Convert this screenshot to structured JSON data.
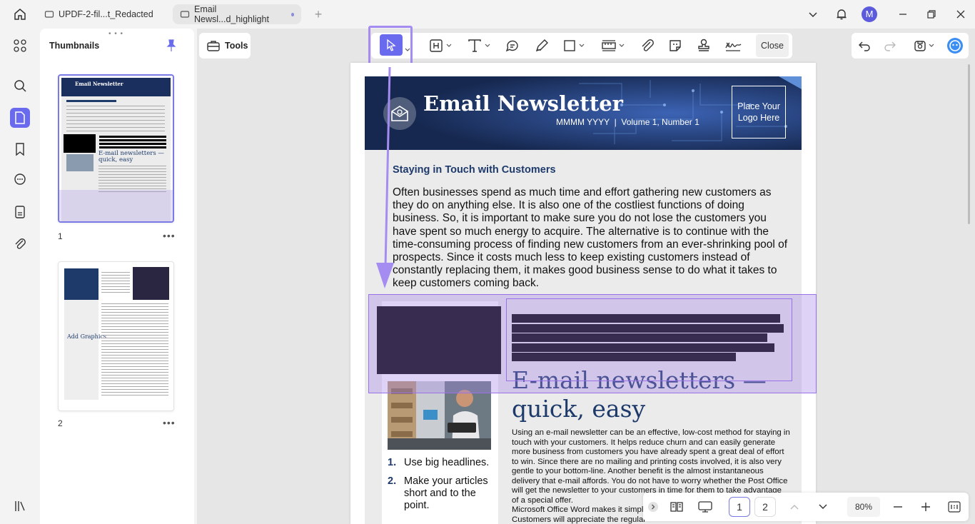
{
  "tabs": [
    {
      "label": "UPDF-2-fil...t_Redacted"
    },
    {
      "label": "Email Newsl...d_highlight"
    }
  ],
  "user": {
    "initial": "M"
  },
  "thumbnails": {
    "title": "Thumbnails",
    "pages": [
      {
        "number": "1"
      },
      {
        "number": "2"
      }
    ]
  },
  "toolbar": {
    "tools_label": "Tools",
    "close_label": "Close"
  },
  "document": {
    "banner_title": "Email Newsletter",
    "banner_subtitle": "MMMM YYYY  |  Volume 1, Number 1",
    "logo_placeholder": "Place Your Logo Here",
    "section_heading": "Staying in Touch with Customers",
    "section_body": "Often businesses spend as much time and effort gathering new customers as they do on anything else. It is also one of the costliest functions of doing business. So, it is important to make sure you do not lose the customers you have spent so much energy to acquire. The alternative is to continue with the time-consuming process of finding new customers from an ever-shrinking pool of prospects. Since it costs much less to keep existing customers instead of constantly replacing them, it makes good business sense to do what it takes to keep customers coming back.",
    "big_heading": "E-mail newsletters — quick, easy",
    "email_body": "Using an e-mail newsletter can be an effective, low-cost method for staying in touch with your customers. It helps reduce churn and can easily generate more business from customers you have already spent a great deal of effort to win. Since there are no mailing and printing costs involved, it is also very gentle to your bottom-line. Another benefit is the almost instantaneous delivery that e-mail affords. You do not have to worry whether the Post Office will get the newsletter to your customers in time for them to take advantage of a special offer.",
    "email_body_2": "Microsoft Office Word makes it simpl",
    "email_body_3": "Customers will appreciate the regular",
    "list": [
      {
        "n": "1.",
        "text": "Use big headlines."
      },
      {
        "n": "2.",
        "text": "Make your articles short and to the point."
      }
    ]
  },
  "bottombar": {
    "page1": "1",
    "page2": "2",
    "zoom": "80%"
  },
  "colors": {
    "accent": "#6a6aee",
    "highlight": "#9a72e8",
    "navy": "#1e3a6b"
  }
}
